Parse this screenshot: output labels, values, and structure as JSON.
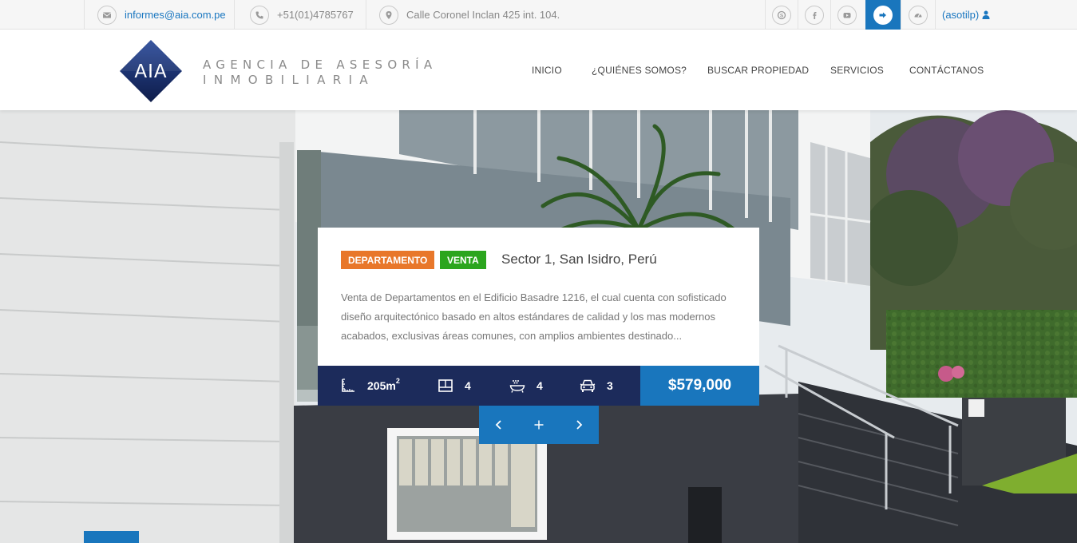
{
  "topbar": {
    "email": "informes@aia.com.pe",
    "phone": "+51(01)4785767",
    "address": "Calle Coronel Inclan 425 int. 104.",
    "user": "(asotilp)"
  },
  "logo": {
    "mark": "AIA",
    "line1": "AGENCIA DE ASESORÍA",
    "line2": "INMOBILIARIA"
  },
  "nav": {
    "inicio": "INICIO",
    "quienes": "¿QUIÉNES SOMOS?",
    "buscar": "BUSCAR PROPIEDAD",
    "servicios": "SERVICIOS",
    "contacto": "CONTÁCTANOS"
  },
  "listing": {
    "type": "DEPARTAMENTO",
    "operation": "VENTA",
    "title": "Sector 1, San Isidro, Perú",
    "description": "Venta de Departamentos en el Edificio Basadre 1216, el cual cuenta con sofisticado diseño arquitectónico basado en altos estándares de calidad y los mas modernos acabados, exclusivas áreas comunes, con amplios ambientes destinado...",
    "area": "205m",
    "area_sup": "2",
    "rooms": "4",
    "baths": "4",
    "parking": "3",
    "price": "$579,000"
  },
  "colors": {
    "brand_blue": "#1976bd",
    "navy": "#1c2b5b",
    "badge_orange": "#e8772a",
    "badge_green": "#2ba51e"
  },
  "icons": [
    "envelope-icon",
    "phone-icon",
    "map-pin-icon",
    "skype-icon",
    "facebook-icon",
    "youtube-icon",
    "sign-out-icon",
    "dashboard-icon",
    "user-icon",
    "area-icon",
    "rooms-icon",
    "bath-icon",
    "car-icon",
    "chevron-left-icon",
    "plus-icon",
    "chevron-right-icon"
  ]
}
